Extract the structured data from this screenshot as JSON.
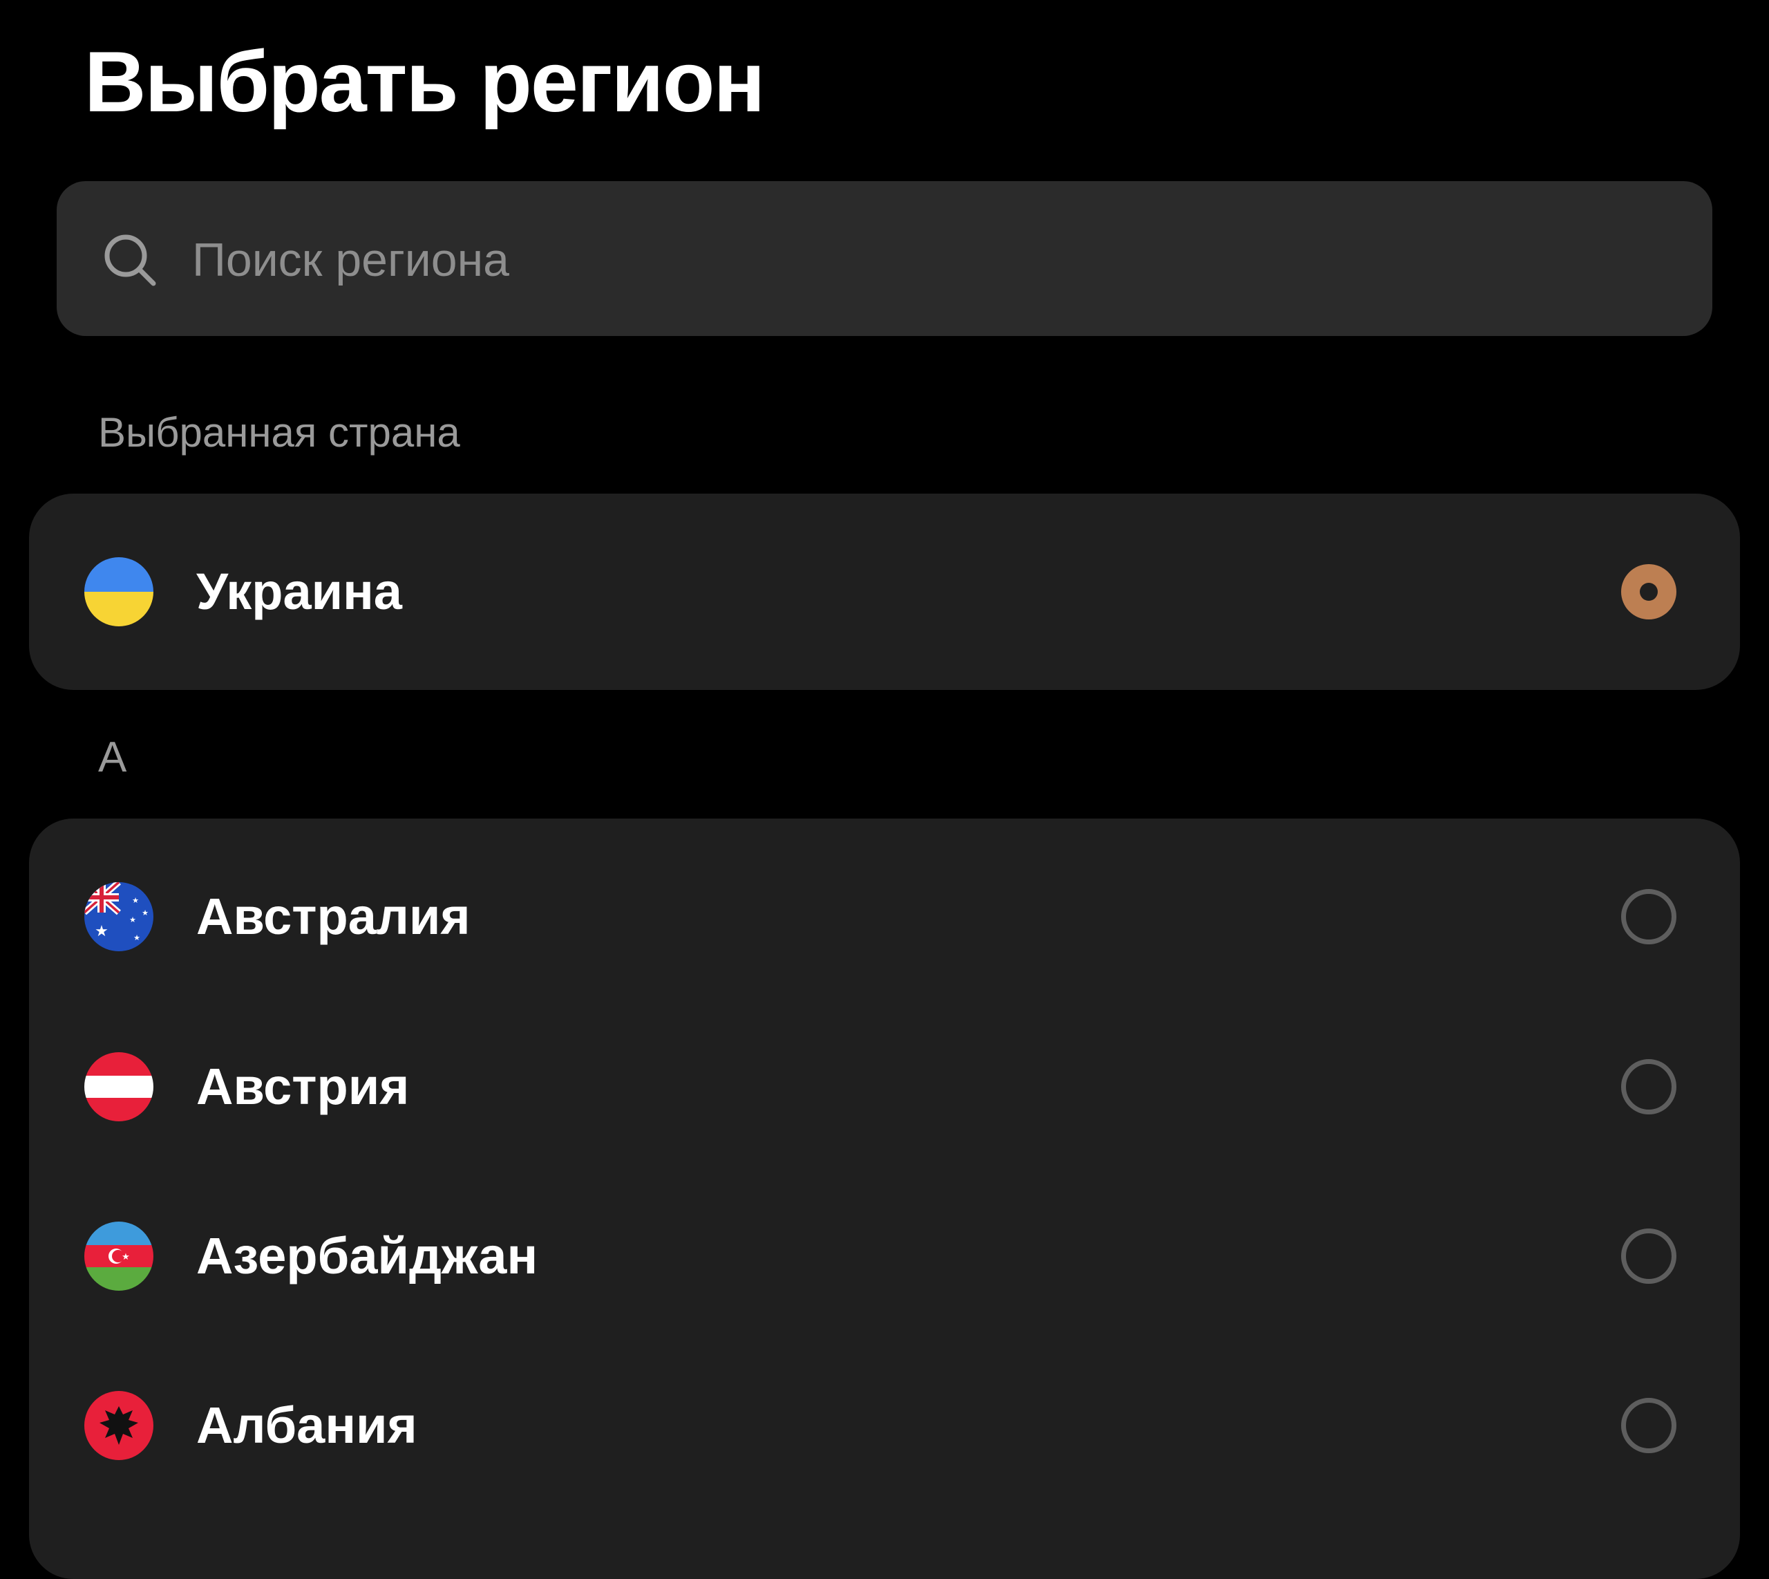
{
  "header": {
    "title": "Выбрать регион"
  },
  "search": {
    "placeholder": "Поиск региона",
    "value": ""
  },
  "selected_section": {
    "label": "Выбранная страна",
    "country": {
      "name": "Украина",
      "flag": "ukraine-flag-icon",
      "selected": true
    }
  },
  "letter_sections": [
    {
      "letter": "А",
      "countries": [
        {
          "name": "Австралия",
          "flag": "australia-flag-icon",
          "selected": false
        },
        {
          "name": "Австрия",
          "flag": "austria-flag-icon",
          "selected": false
        },
        {
          "name": "Азербайджан",
          "flag": "azerbaijan-flag-icon",
          "selected": false
        },
        {
          "name": "Албания",
          "flag": "albania-flag-icon",
          "selected": false
        }
      ]
    }
  ],
  "colors": {
    "background": "#000000",
    "card": "#1f1f1f",
    "search_field": "#2b2b2b",
    "accent_radio": "#bd7f52",
    "radio_unselected_ring": "#5e5e5e",
    "section_label": "#9a9a9a",
    "placeholder": "#8e8e8e"
  }
}
